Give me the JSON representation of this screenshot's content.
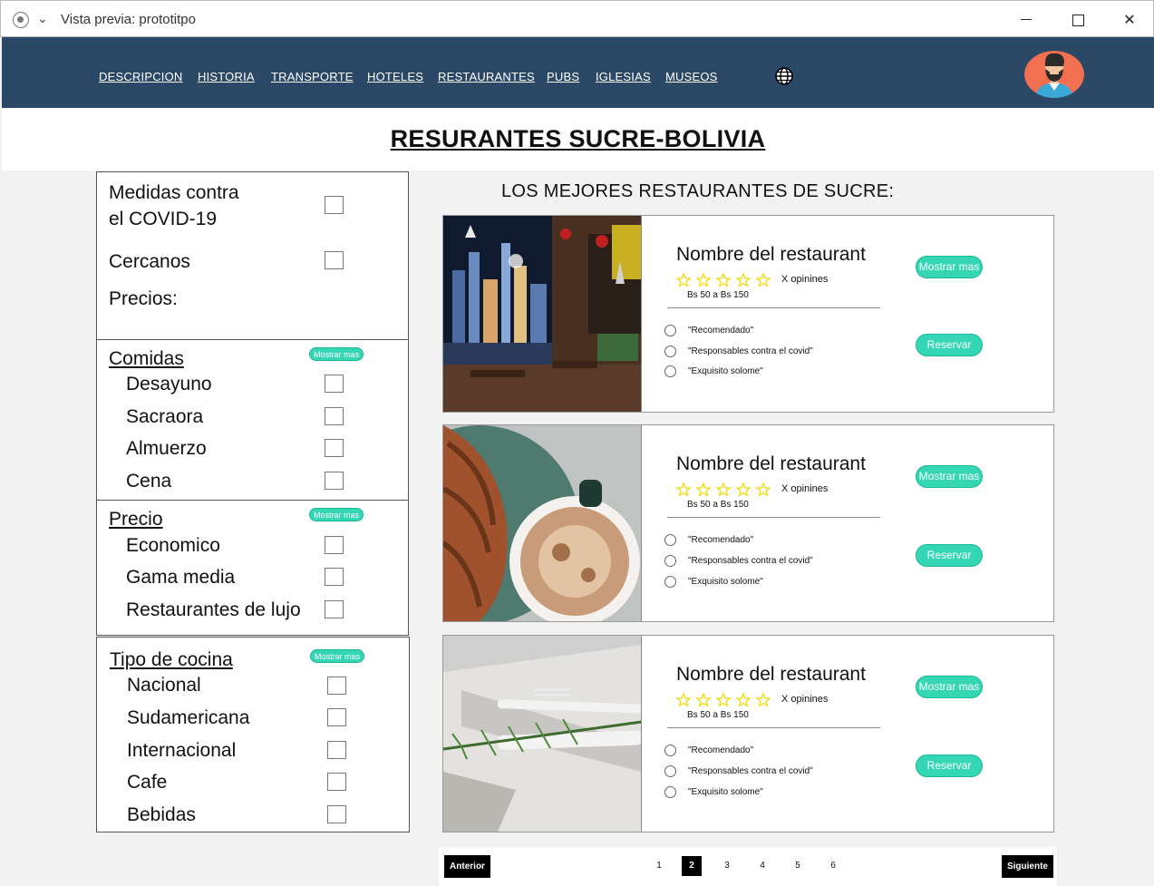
{
  "window": {
    "title": "Vista previa: prototitpo",
    "close_glyph": "✕"
  },
  "nav": {
    "links": [
      "DESCRIPCION",
      "HISTORIA",
      "TRANSPORTE",
      "HOTELES",
      "RESTAURANTES",
      "PUBS",
      "IGLESIAS",
      "MUSEOS"
    ],
    "language_icon": "globe-icon",
    "profile_icon": "user-avatar"
  },
  "page": {
    "title": "RESURANTES SUCRE-BOLIVIA",
    "list_title": "LOS MEJORES RESTAURANTES DE SUCRE:"
  },
  "filters": {
    "covid_line1": "Medidas contra",
    "covid_line2": "el COVID-19",
    "nearby": "Cercanos",
    "prices": "Precios:",
    "show_more": "Mostrar mas",
    "groups": [
      {
        "heading": "Comidas",
        "items": [
          "Desayuno",
          "Sacraora",
          "Almuerzo",
          "Cena"
        ]
      },
      {
        "heading": "Precio",
        "items": [
          "Economico",
          "Gama media",
          "Restaurantes de lujo"
        ]
      },
      {
        "heading": "Tipo de cocina",
        "items": [
          "Nacional",
          "Sudamericana",
          "Internacional",
          "Cafe",
          "Bebidas"
        ]
      }
    ]
  },
  "cards": [
    {
      "name": "Nombre del restaurant",
      "rating_stars": 5,
      "opinions": "X opinines",
      "price": "Bs 50 a Bs 150",
      "options": [
        "\"Recomendado\"",
        "\"Responsables contra el covid\"",
        "\"Exquisito solome\""
      ],
      "more_label": "Mostrar mas",
      "reserve_label": "Reservar",
      "image": "restaurant-interior-photo"
    },
    {
      "name": "Nombre del restaurant",
      "rating_stars": 5,
      "opinions": "X opinines",
      "price": "Bs 50 a Bs 150",
      "options": [
        "\"Recomendado\"",
        "\"Responsables contra el covid\"",
        "\"Exquisito solome\""
      ],
      "more_label": "Mostrar mas",
      "reserve_label": "Reservar",
      "image": "croissant-coffee-photo"
    },
    {
      "name": "Nombre del restaurant",
      "rating_stars": 5,
      "opinions": "X opinines",
      "price": "Bs 50 a Bs 150",
      "options": [
        "\"Recomendado\"",
        "\"Responsables contra el covid\"",
        "\"Exquisito solome\""
      ],
      "more_label": "Mostrar mas",
      "reserve_label": "Reservar",
      "image": "cutlery-rosemary-photo"
    }
  ],
  "pagination": {
    "prev": "Anterior",
    "next": "Siguiente",
    "pages": [
      "1",
      "2",
      "3",
      "4",
      "5",
      "6"
    ],
    "current": "2"
  },
  "colors": {
    "navbar": "#2b4966",
    "accent": "#35d6b4",
    "star": "#f2d90b"
  }
}
